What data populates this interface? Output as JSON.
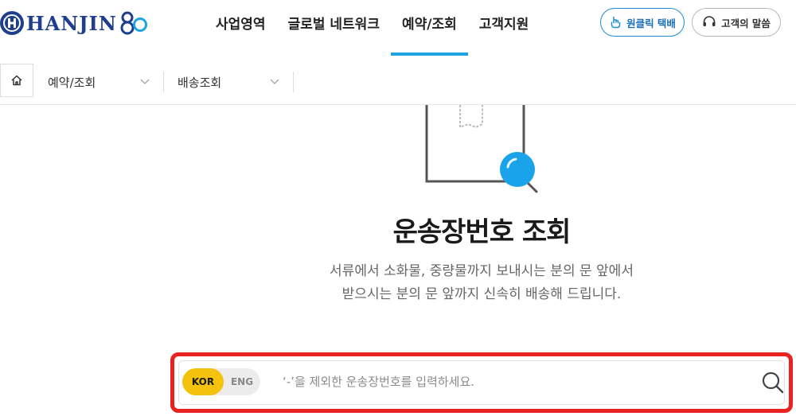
{
  "logo": {
    "text": "HANJIN",
    "mark_letter": "H"
  },
  "nav": [
    {
      "label": "사업영역"
    },
    {
      "label": "글로벌 네트워크"
    },
    {
      "label": "예약/조회",
      "active": true
    },
    {
      "label": "고객지원"
    }
  ],
  "header_buttons": {
    "oneclick": "원클릭 택배",
    "voice": "고객의 말씀"
  },
  "breadcrumb": {
    "level1": "예약/조회",
    "level2": "배송조회"
  },
  "page": {
    "title": "운송장번호 조회",
    "desc_line1": "서류에서 소화물, 중량물까지 보내시는 분의 문 앞에서",
    "desc_line2": "받으시는 분의 문 앞까지 신속히 배송해 드립니다."
  },
  "search": {
    "lang_kor": "KOR",
    "lang_eng": "ENG",
    "placeholder": "‘-’을 제외한 운송장번호를 입력하세요."
  },
  "colors": {
    "brand": "#1f3f8e",
    "accent": "#1ea3e0",
    "highlight": "#e8231f",
    "lang_active": "#f4c20d"
  }
}
